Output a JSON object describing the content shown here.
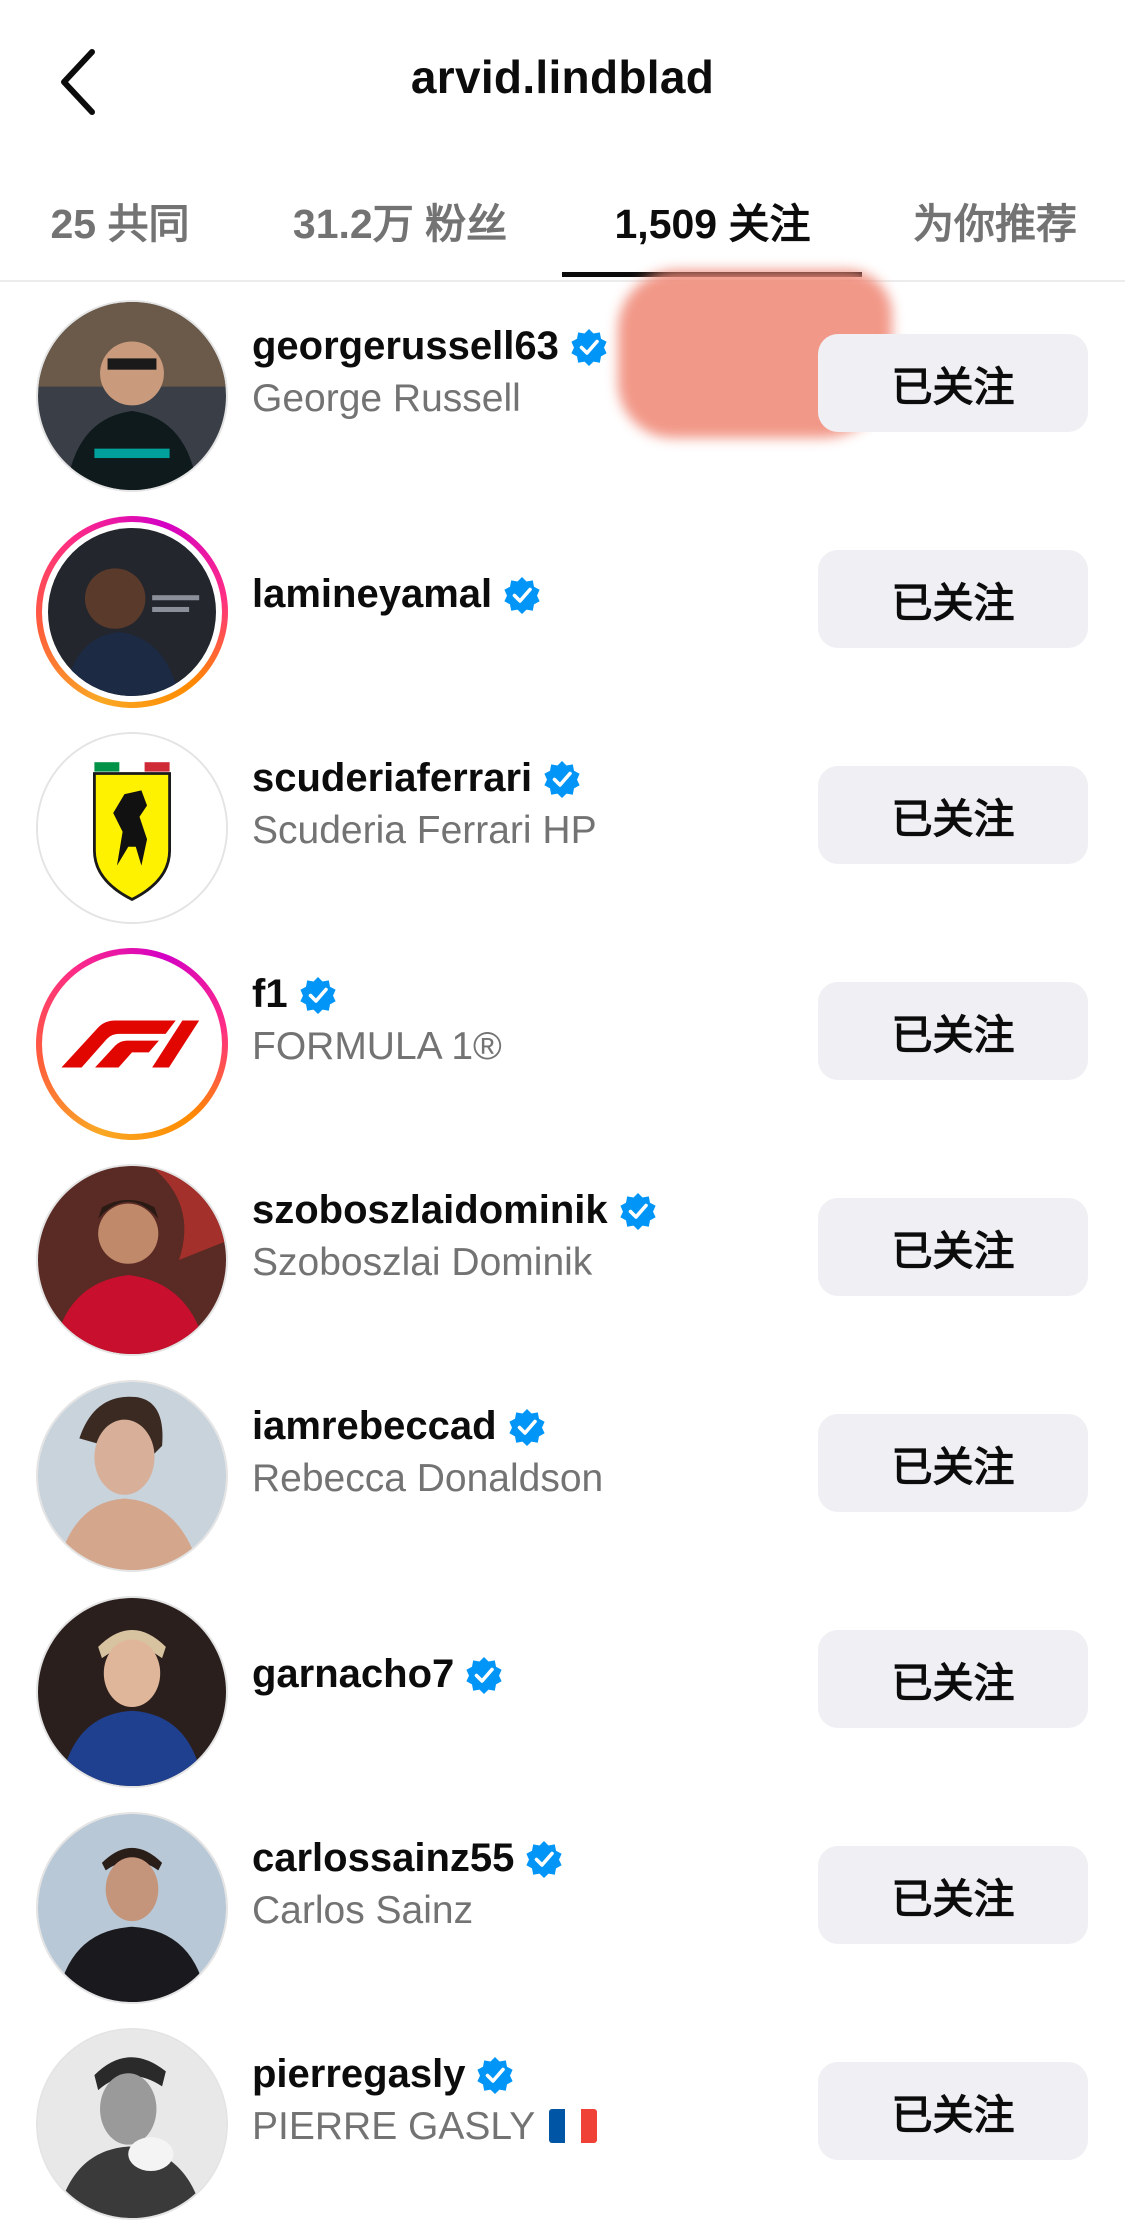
{
  "header": {
    "title": "arvid.lindblad"
  },
  "tabs": [
    {
      "label": "25 共同"
    },
    {
      "label": "31.2万 粉丝"
    },
    {
      "label": "1,509 关注"
    },
    {
      "label": "为你推荐"
    }
  ],
  "colors": {
    "verified": "#0095f6",
    "button_bg": "#efeff4",
    "secondary_text": "#737373",
    "redaction": "#f08a78"
  },
  "accounts": [
    {
      "username": "georgerussell63",
      "name": "George Russell",
      "button": "已关注",
      "story_ring": false
    },
    {
      "username": "lamineyamal",
      "name": "",
      "button": "已关注",
      "story_ring": true
    },
    {
      "username": "scuderiaferrari",
      "name": "Scuderia Ferrari HP",
      "button": "已关注",
      "story_ring": false
    },
    {
      "username": "f1",
      "name": "FORMULA 1®",
      "button": "已关注",
      "story_ring": true
    },
    {
      "username": "szoboszlaidominik",
      "name": "Szoboszlai Dominik",
      "button": "已关注",
      "story_ring": false
    },
    {
      "username": "iamrebeccad",
      "name": "Rebecca Donaldson",
      "button": "已关注",
      "story_ring": false
    },
    {
      "username": "garnacho7",
      "name": "",
      "button": "已关注",
      "story_ring": false
    },
    {
      "username": "carlossainz55",
      "name": "Carlos Sainz",
      "button": "已关注",
      "story_ring": false
    },
    {
      "username": "pierregasly",
      "name": "PIERRE GASLY",
      "button": "已关注",
      "story_ring": false,
      "name_emoji": "flag-france"
    }
  ]
}
